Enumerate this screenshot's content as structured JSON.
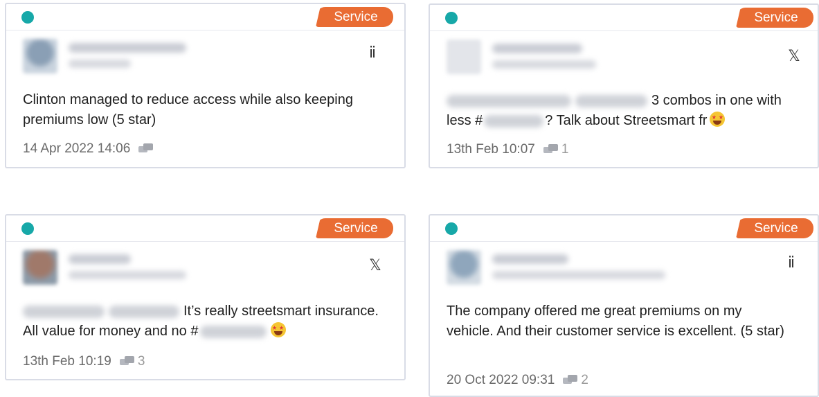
{
  "cards": [
    {
      "tag": "Service",
      "source_icon": "trustpilot-icon",
      "text": "Clinton managed to reduce access while also keeping premiums low (5 star)",
      "date": "14 Apr 2022 14:06",
      "comment_count": ""
    },
    {
      "tag": "Service",
      "source_icon": "x-twitter-icon",
      "text_before": "3 combos in one with less #",
      "text_after": "? Talk about Streetsmart fr",
      "date": "13th Feb 10:07",
      "comment_count": "1"
    },
    {
      "tag": "Service",
      "source_icon": "x-twitter-icon",
      "text_before": "It’s really streetsmart insurance. All value for money and no #",
      "date": "13th Feb 10:19",
      "comment_count": "3"
    },
    {
      "tag": "Service",
      "source_icon": "trustpilot-icon",
      "text": "The company offered me great premiums on my vehicle. And their customer service is excellent. (5 star)",
      "date": "20 Oct 2022 09:31",
      "comment_count": "2"
    }
  ],
  "colors": {
    "status_dot": "#17a8a8",
    "tag": "#e96c33",
    "border": "#d9dce6"
  }
}
